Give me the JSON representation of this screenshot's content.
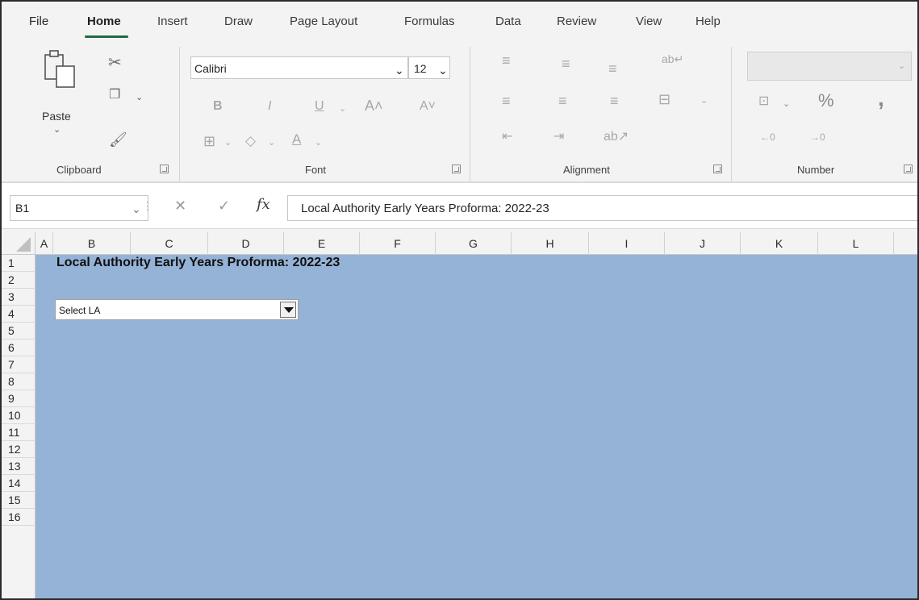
{
  "tabs": [
    "File",
    "Home",
    "Insert",
    "Draw",
    "Page Layout",
    "Formulas",
    "Data",
    "Review",
    "View",
    "Help"
  ],
  "active_tab": "Home",
  "ribbon": {
    "clipboard": {
      "label": "Clipboard",
      "paste_label": "Paste"
    },
    "font": {
      "label": "Font",
      "font_name": "Calibri",
      "font_size": "12"
    },
    "alignment": {
      "label": "Alignment"
    },
    "number": {
      "label": "Number",
      "percent": "%",
      "comma": ","
    }
  },
  "formula_bar": {
    "name_box": "B1",
    "fx": "fx",
    "formula": "Local Authority Early Years Proforma: 2022-23"
  },
  "grid": {
    "columns": [
      "A",
      "B",
      "C",
      "D",
      "E",
      "F",
      "G",
      "H",
      "I",
      "J",
      "K",
      "L"
    ],
    "rows": [
      "1",
      "2",
      "3",
      "4",
      "5",
      "6",
      "7",
      "8",
      "9",
      "10",
      "11",
      "12",
      "13",
      "14",
      "15",
      "16"
    ],
    "title_cell": "Local Authority Early Years Proforma: 2022-23",
    "dropdown_value": "Select LA"
  },
  "colors": {
    "sheet_background": "#95b3d7",
    "active_tab_underline": "#1e6b43"
  }
}
